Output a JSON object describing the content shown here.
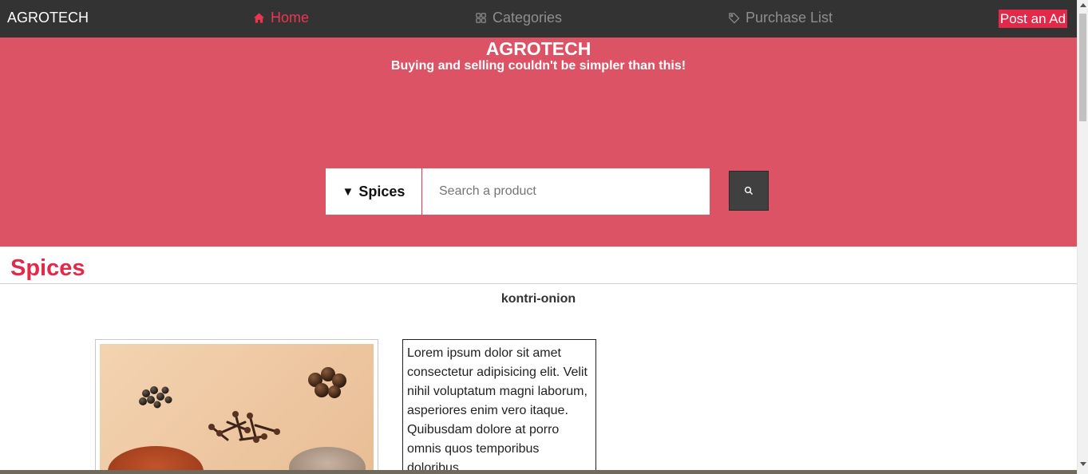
{
  "nav": {
    "brand": "AGROTECH",
    "items": [
      {
        "label": "Home",
        "icon": "home-icon",
        "active": true
      },
      {
        "label": "Categories",
        "icon": "grid-icon",
        "active": false
      },
      {
        "label": "Purchase List",
        "icon": "tag-icon",
        "active": false
      }
    ],
    "post_ad_label": "Post an Ad"
  },
  "hero": {
    "title": "AGROTECH",
    "subtitle": "Buying and selling couldn't be simpler than this!",
    "category_selected": "Spices",
    "search_placeholder": "Search a product",
    "search_icon": "search-icon"
  },
  "content": {
    "section_title": "Spices",
    "product_name": "kontri-onion",
    "product_image": "spices-photo",
    "description": "Lorem ipsum dolor sit amet consectetur adipisicing elit. Velit nihil voluptatum magni laborum, asperiores enim vero itaque. Quibusdam dolore at porro omnis quos temporibus doloribus"
  },
  "colors": {
    "accent": "#e3294a",
    "hero_bg": "#dc5366",
    "nav_bg": "#333333"
  }
}
